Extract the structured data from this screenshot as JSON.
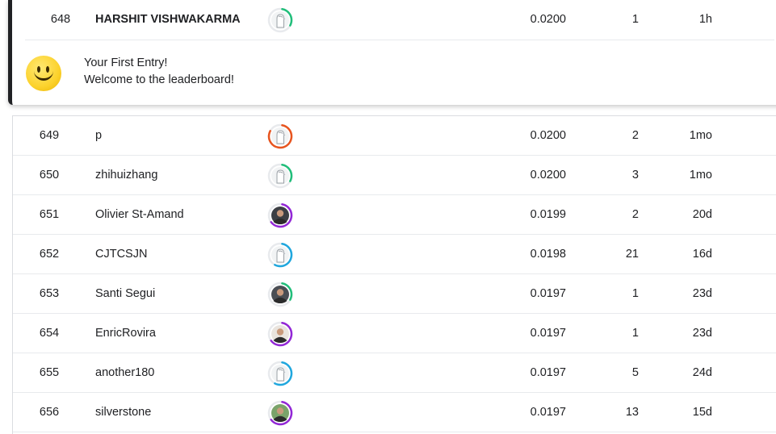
{
  "current_user": {
    "rank": "648",
    "name": "HARSHIT VISHWAKARMA",
    "score": "0.0200",
    "entries": "1",
    "last": "1h",
    "avatar": {
      "type": "default",
      "ring_color": "#20be7a",
      "ring_fraction": 0.3
    },
    "message": {
      "icon": "smiley-face-icon",
      "line1": "Your First Entry!",
      "line2": "Welcome to the leaderboard!"
    }
  },
  "rows": [
    {
      "rank": "649",
      "name": "p",
      "score": "0.0200",
      "entries": "2",
      "last": "1mo",
      "avatar": {
        "type": "default",
        "ring_color": "#e8541e",
        "ring_fraction": 0.8
      }
    },
    {
      "rank": "650",
      "name": "zhihuizhang",
      "score": "0.0200",
      "entries": "3",
      "last": "1mo",
      "avatar": {
        "type": "default",
        "ring_color": "#20be7a",
        "ring_fraction": 0.3
      }
    },
    {
      "rank": "651",
      "name": "Olivier St-Amand",
      "score": "0.0199",
      "entries": "2",
      "last": "20d",
      "avatar": {
        "type": "photo",
        "photo_bg": "#3c3f44",
        "ring_color": "#9226d6",
        "ring_fraction": 0.62
      }
    },
    {
      "rank": "652",
      "name": "CJTCSJN",
      "score": "0.0198",
      "entries": "21",
      "last": "16d",
      "avatar": {
        "type": "default",
        "ring_color": "#1fa7de",
        "ring_fraction": 0.55
      }
    },
    {
      "rank": "653",
      "name": "Santi Segui",
      "score": "0.0197",
      "entries": "1",
      "last": "23d",
      "avatar": {
        "type": "photo",
        "photo_bg": "#4a4e54",
        "ring_color": "#20be7a",
        "ring_fraction": 0.3
      }
    },
    {
      "rank": "654",
      "name": "EnricRovira",
      "score": "0.0197",
      "entries": "1",
      "last": "23d",
      "avatar": {
        "type": "photo",
        "photo_bg": "#e9e4de",
        "ring_color": "#9226d6",
        "ring_fraction": 0.62
      }
    },
    {
      "rank": "655",
      "name": "another180",
      "score": "0.0197",
      "entries": "5",
      "last": "24d",
      "avatar": {
        "type": "default",
        "ring_color": "#1fa7de",
        "ring_fraction": 0.55
      }
    },
    {
      "rank": "656",
      "name": "silverstone",
      "score": "0.0197",
      "entries": "13",
      "last": "15d",
      "avatar": {
        "type": "photo",
        "photo_bg": "#7aa36a",
        "ring_color": "#9226d6",
        "ring_fraction": 0.62
      }
    }
  ]
}
